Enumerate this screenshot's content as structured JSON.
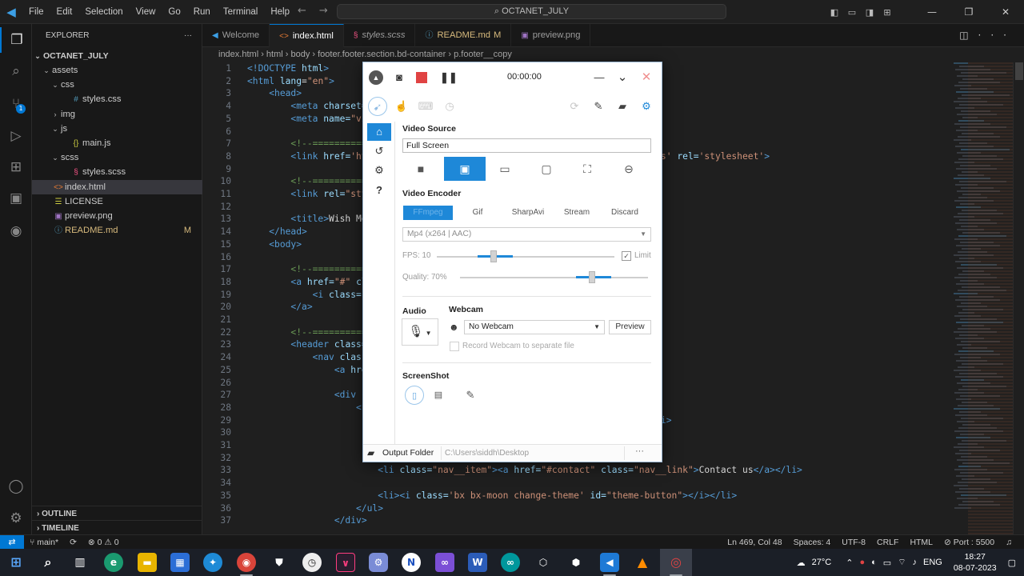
{
  "titlebar": {
    "logo": "◀",
    "menu": [
      "File",
      "Edit",
      "Selection",
      "View",
      "Go",
      "Run",
      "Terminal",
      "Help"
    ],
    "search": "OCTANET_JULY",
    "nav_back": "←",
    "nav_forward": "→",
    "win_min": "—",
    "win_max": "❐",
    "win_close": "✕"
  },
  "explorer": {
    "title": "EXPLORER",
    "more": "···",
    "root": "OCTANET_JULY",
    "items": [
      {
        "label": "assets",
        "indent": 1,
        "kind": "folder",
        "open": true
      },
      {
        "label": "css",
        "indent": 2,
        "kind": "folder",
        "open": true
      },
      {
        "label": "styles.css",
        "indent": 3,
        "kind": "css"
      },
      {
        "label": "img",
        "indent": 2,
        "kind": "folder",
        "open": false
      },
      {
        "label": "js",
        "indent": 2,
        "kind": "folder",
        "open": true
      },
      {
        "label": "main.js",
        "indent": 3,
        "kind": "js"
      },
      {
        "label": "scss",
        "indent": 2,
        "kind": "folder",
        "open": true
      },
      {
        "label": "styles.scss",
        "indent": 3,
        "kind": "scss"
      },
      {
        "label": "index.html",
        "indent": 1,
        "kind": "html",
        "selected": true
      },
      {
        "label": "LICENSE",
        "indent": 1,
        "kind": "license"
      },
      {
        "label": "preview.png",
        "indent": 1,
        "kind": "img"
      },
      {
        "label": "README.md",
        "indent": 1,
        "kind": "md",
        "mark": "M"
      }
    ],
    "outline": "OUTLINE",
    "timeline": "TIMELINE"
  },
  "tabs": [
    {
      "label": "Welcome",
      "icon": "vscode-icon",
      "mod": ""
    },
    {
      "label": "index.html",
      "icon": "html-icon",
      "mod": "",
      "active": true
    },
    {
      "label": "styles.scss",
      "icon": "scss-icon",
      "mod": "",
      "italic": true
    },
    {
      "label": "README.md",
      "icon": "info-icon",
      "mod": "M"
    },
    {
      "label": "preview.png",
      "icon": "image-icon",
      "mod": ""
    }
  ],
  "breadcrumb": [
    "index.html",
    "html",
    "body",
    "footer.footer.section.bd-container",
    "p.footer__copy"
  ],
  "code": [
    {
      "n": "1",
      "parts": [
        [
          "tag",
          "<!DOCTYPE "
        ],
        [
          "attr",
          "html"
        ],
        [
          "tag",
          ">"
        ]
      ]
    },
    {
      "n": "2",
      "parts": [
        [
          "tag",
          "<html "
        ],
        [
          "attr",
          "lang"
        ],
        [
          "txt",
          "="
        ],
        [
          "str",
          "\"en\""
        ],
        [
          "tag",
          ">"
        ]
      ]
    },
    {
      "n": "3",
      "parts": [
        [
          "txt",
          "    "
        ],
        [
          "tag",
          "<head>"
        ]
      ]
    },
    {
      "n": "4",
      "parts": [
        [
          "txt",
          "        "
        ],
        [
          "tag",
          "<meta "
        ],
        [
          "attr",
          "charset="
        ]
      ]
    },
    {
      "n": "5",
      "parts": [
        [
          "txt",
          "        "
        ],
        [
          "tag",
          "<meta "
        ],
        [
          "attr",
          "name="
        ],
        [
          "str",
          "\"vi"
        ]
      ]
    },
    {
      "n": "6",
      "parts": []
    },
    {
      "n": "7",
      "parts": [
        [
          "txt",
          "        "
        ],
        [
          "cmt",
          "<!--==========="
        ]
      ]
    },
    {
      "n": "8",
      "parts": [
        [
          "txt",
          "        "
        ],
        [
          "tag",
          "<link "
        ],
        [
          "attr",
          "href="
        ],
        [
          "str",
          "'ht"
        ],
        [
          "txt",
          "                                                    "
        ],
        [
          "str",
          "css'"
        ],
        [
          "txt",
          " "
        ],
        [
          "attr",
          "rel="
        ],
        [
          "str",
          "'stylesheet'"
        ],
        [
          "tag",
          ">"
        ]
      ]
    },
    {
      "n": "9",
      "parts": []
    },
    {
      "n": "10",
      "parts": [
        [
          "txt",
          "        "
        ],
        [
          "cmt",
          "<!--==========="
        ]
      ]
    },
    {
      "n": "11",
      "parts": [
        [
          "txt",
          "        "
        ],
        [
          "tag",
          "<link "
        ],
        [
          "attr",
          "rel="
        ],
        [
          "str",
          "\"sty"
        ]
      ]
    },
    {
      "n": "12",
      "parts": []
    },
    {
      "n": "13",
      "parts": [
        [
          "txt",
          "        "
        ],
        [
          "tag",
          "<title>"
        ],
        [
          "txt",
          "Wish Me"
        ]
      ]
    },
    {
      "n": "14",
      "parts": [
        [
          "txt",
          "    "
        ],
        [
          "tag",
          "</head>"
        ]
      ]
    },
    {
      "n": "15",
      "parts": [
        [
          "txt",
          "    "
        ],
        [
          "tag",
          "<body>"
        ]
      ]
    },
    {
      "n": "16",
      "parts": []
    },
    {
      "n": "17",
      "parts": [
        [
          "txt",
          "        "
        ],
        [
          "cmt",
          "<!--==========="
        ]
      ]
    },
    {
      "n": "18",
      "parts": [
        [
          "txt",
          "        "
        ],
        [
          "tag",
          "<a "
        ],
        [
          "attr",
          "href="
        ],
        [
          "str",
          "\"#\""
        ],
        [
          "txt",
          " "
        ],
        [
          "attr",
          "cl"
        ]
      ]
    },
    {
      "n": "19",
      "parts": [
        [
          "txt",
          "            "
        ],
        [
          "tag",
          "<i "
        ],
        [
          "attr",
          "class="
        ],
        [
          "str",
          "'"
        ]
      ]
    },
    {
      "n": "20",
      "parts": [
        [
          "txt",
          "        "
        ],
        [
          "tag",
          "</a>"
        ]
      ]
    },
    {
      "n": "21",
      "parts": []
    },
    {
      "n": "22",
      "parts": [
        [
          "txt",
          "        "
        ],
        [
          "cmt",
          "<!--==========="
        ]
      ]
    },
    {
      "n": "23",
      "parts": [
        [
          "txt",
          "        "
        ],
        [
          "tag",
          "<header "
        ],
        [
          "attr",
          "class="
        ]
      ]
    },
    {
      "n": "24",
      "parts": [
        [
          "txt",
          "            "
        ],
        [
          "tag",
          "<nav "
        ],
        [
          "attr",
          "class"
        ]
      ]
    },
    {
      "n": "25",
      "parts": [
        [
          "txt",
          "                "
        ],
        [
          "tag",
          "<a "
        ],
        [
          "attr",
          "hre"
        ]
      ]
    },
    {
      "n": "26",
      "parts": []
    },
    {
      "n": "27",
      "parts": [
        [
          "txt",
          "                "
        ],
        [
          "tag",
          "<div "
        ],
        [
          "attr",
          "c"
        ]
      ]
    },
    {
      "n": "28",
      "parts": [
        [
          "txt",
          "                    "
        ],
        [
          "tag",
          "<u"
        ]
      ]
    },
    {
      "n": "29",
      "parts": [
        [
          "txt",
          "                                                      "
        ],
        [
          "str",
          "tive-link\""
        ],
        [
          "tag",
          ">"
        ],
        [
          "txt",
          "Home"
        ],
        [
          "tag",
          "</a></li>"
        ]
      ]
    },
    {
      "n": "30",
      "parts": [
        [
          "txt",
          "                                                      "
        ],
        [
          "txt",
          "About"
        ],
        [
          "tag",
          "</a></li>"
        ]
      ]
    },
    {
      "n": "31",
      "parts": [
        [
          "txt",
          "                                                      "
        ],
        [
          "str",
          "k\""
        ],
        [
          "tag",
          ">"
        ],
        [
          "txt",
          "Services"
        ],
        [
          "tag",
          "</a></li>"
        ]
      ]
    },
    {
      "n": "32",
      "parts": [
        [
          "txt",
          "                                                      "
        ],
        [
          "txt",
          "enu"
        ],
        [
          "tag",
          "</a></li>"
        ]
      ]
    },
    {
      "n": "33",
      "parts": [
        [
          "txt",
          "                        "
        ],
        [
          "tag",
          "<li "
        ],
        [
          "attr",
          "class="
        ],
        [
          "str",
          "\"nav__item\""
        ],
        [
          "tag",
          "><a "
        ],
        [
          "attr",
          "href="
        ],
        [
          "str",
          "\"#contact\""
        ],
        [
          "txt",
          " "
        ],
        [
          "attr",
          "class="
        ],
        [
          "str",
          "\"nav__link\""
        ],
        [
          "tag",
          ">"
        ],
        [
          "txt",
          "Contact us"
        ],
        [
          "tag",
          "</a></li>"
        ]
      ]
    },
    {
      "n": "34",
      "parts": []
    },
    {
      "n": "35",
      "parts": [
        [
          "txt",
          "                        "
        ],
        [
          "tag",
          "<li><i "
        ],
        [
          "attr",
          "class="
        ],
        [
          "str",
          "'bx bx-moon change-theme'"
        ],
        [
          "txt",
          " "
        ],
        [
          "attr",
          "id="
        ],
        [
          "str",
          "\"theme-button\""
        ],
        [
          "tag",
          "></i></li>"
        ]
      ]
    },
    {
      "n": "36",
      "parts": [
        [
          "txt",
          "                    "
        ],
        [
          "tag",
          "</ul>"
        ]
      ]
    },
    {
      "n": "37",
      "parts": [
        [
          "txt",
          "                "
        ],
        [
          "tag",
          "</div>"
        ]
      ]
    }
  ],
  "statusbar": {
    "remote": "⇄",
    "branch": "main*",
    "sync": "⟳",
    "problems": "⊗ 0 ⚠ 0",
    "position": "Ln 469, Col 48",
    "spaces": "Spaces: 4",
    "encoding": "UTF-8",
    "eol": "CRLF",
    "language": "HTML",
    "port": "⊘ Port : 5500",
    "bell": "🔔"
  },
  "taskbar": {
    "weather": "27°C",
    "lang": "ENG",
    "time": "18:27",
    "date": "08-07-2023",
    "apps": [
      "start",
      "search",
      "task-view",
      "edge",
      "files",
      "store",
      "safari",
      "chrome",
      "brave",
      "opera",
      "capcut",
      "settings",
      "notion",
      "visual-studio",
      "word",
      "arduino",
      "cube1",
      "cube2",
      "vscode",
      "vlc",
      "recorder"
    ]
  },
  "recorder": {
    "timer": "00:00:00",
    "min": "—",
    "collapse": "⌄",
    "close": "✕",
    "video_source": "Video Source",
    "source_value": "Full Screen",
    "video_encoder": "Video Encoder",
    "encoders": [
      "FFmpeg",
      "Gif",
      "SharpAvi",
      "Stream",
      "Discard"
    ],
    "format": "Mp4 (x264 | AAC)",
    "fps_label": "FPS:",
    "fps_value": "10",
    "fps_fraction": 0.32,
    "limit": "Limit",
    "quality_label": "Quality:",
    "quality_value": "70%",
    "quality_fraction": 0.7,
    "audio": "Audio",
    "webcam": "Webcam",
    "webcam_value": "No Webcam",
    "preview": "Preview",
    "record_webcam": "Record Webcam to separate file",
    "screenshot": "ScreenShot",
    "output_folder": "Output Folder",
    "output_path": "C:\\Users\\siddh\\Desktop",
    "more": "···",
    "colors": {
      "accent": "#1e88d8",
      "stop": "#e04343"
    }
  }
}
